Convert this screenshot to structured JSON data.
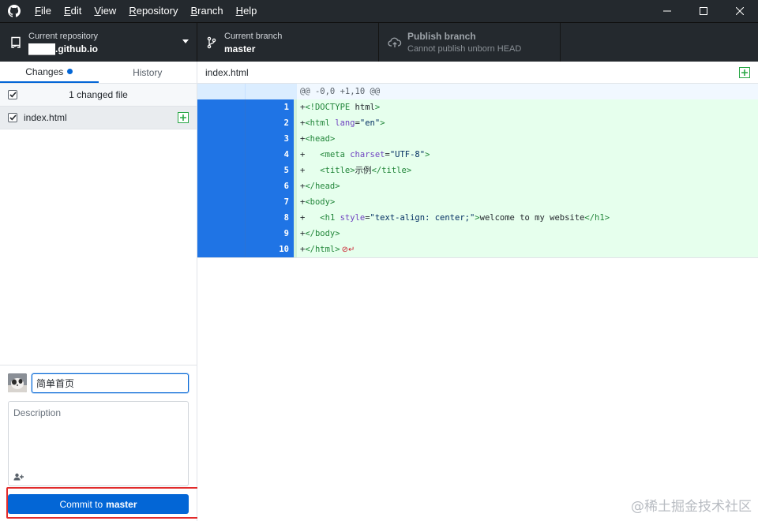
{
  "menu": {
    "items": [
      {
        "key": "F",
        "rest": "ile"
      },
      {
        "key": "E",
        "rest": "dit"
      },
      {
        "key": "V",
        "rest": "iew"
      },
      {
        "key": "R",
        "rest": "epository"
      },
      {
        "key": "B",
        "rest": "ranch"
      },
      {
        "key": "H",
        "rest": "elp"
      }
    ]
  },
  "toolbar": {
    "repo_label": "Current repository",
    "repo_value": "████.github.io",
    "branch_label": "Current branch",
    "branch_value": "master",
    "publish_label": "Publish branch",
    "publish_value": "Cannot publish unborn HEAD"
  },
  "sidebar": {
    "tabs": [
      {
        "label": "Changes",
        "active": true
      },
      {
        "label": "History",
        "active": false
      }
    ],
    "changed_files_text": "1 changed file",
    "files": [
      {
        "name": "index.html",
        "status": "added"
      }
    ]
  },
  "commit": {
    "summary_value": "简单首页",
    "description_placeholder": "Description",
    "button_prefix": "Commit to",
    "button_branch": "master"
  },
  "diff": {
    "filename": "index.html",
    "hunk_header": "@@ -0,0 +1,10 @@",
    "lines": [
      {
        "num": "1",
        "text": "+<!DOCTYPE html>"
      },
      {
        "num": "2",
        "text": "+<html lang=\"en\">"
      },
      {
        "num": "3",
        "text": "+<head>"
      },
      {
        "num": "4",
        "text": "+   <meta charset=\"UTF-8\">"
      },
      {
        "num": "5",
        "text": "+   <title>示例</title>"
      },
      {
        "num": "6",
        "text": "+</head>"
      },
      {
        "num": "7",
        "text": "+<body>"
      },
      {
        "num": "8",
        "text": "+   <h1 style=\"text-align: center;\">welcome to my website</h1>"
      },
      {
        "num": "9",
        "text": "+</body>"
      },
      {
        "num": "10",
        "text": "+</html>",
        "no_newline": true
      }
    ]
  },
  "watermark": "@稀土掘金技术社区",
  "colors": {
    "accent": "#0366d6",
    "titlebar": "#24292e",
    "added_bg": "#e6ffed",
    "line_number_bg": "#1f74e5",
    "highlight": "#e12b2b"
  }
}
